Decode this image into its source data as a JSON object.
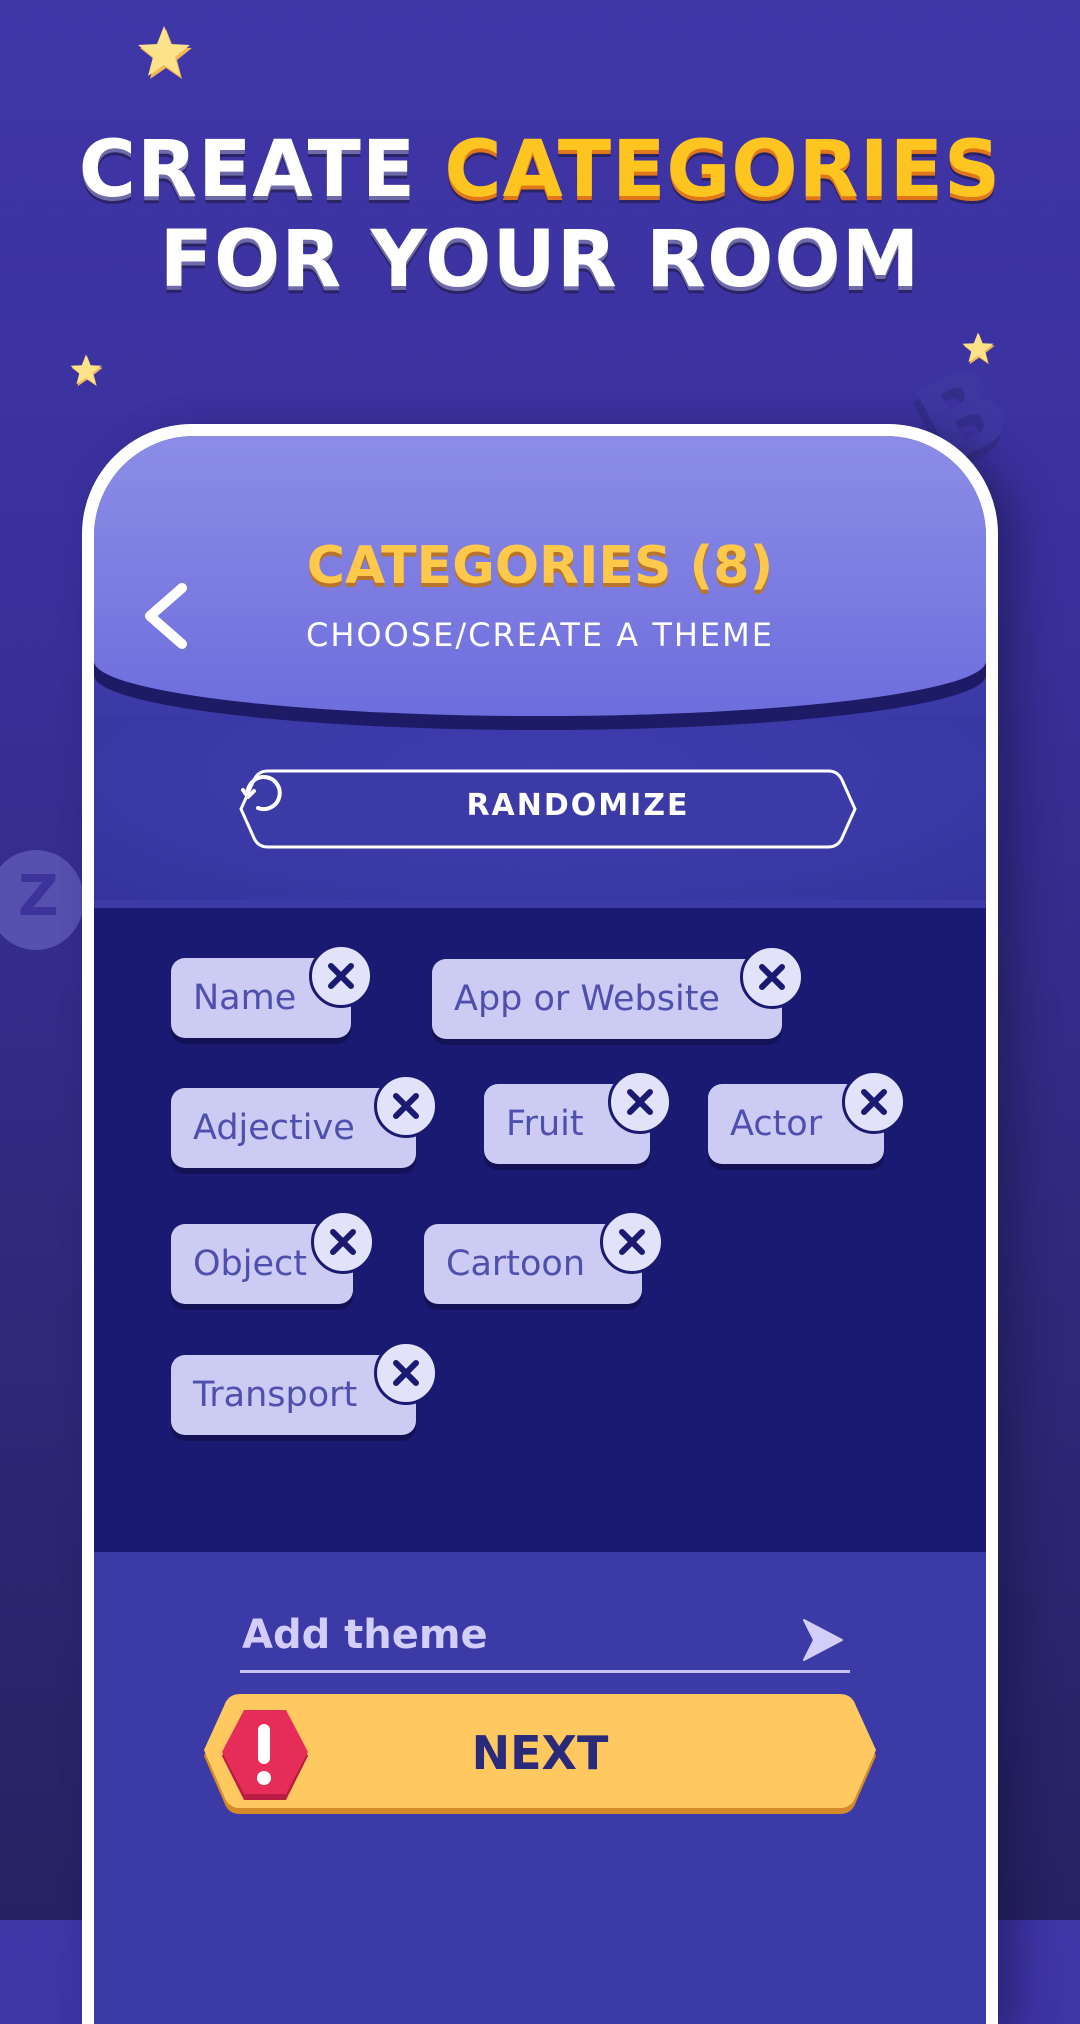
{
  "promo": {
    "line1_prefix": "CREATE ",
    "line1_highlight": "CATEGORIES",
    "line2": "FOR YOUR ROOM"
  },
  "decorations": {
    "letter_right": "B",
    "letter_left": "Z"
  },
  "header": {
    "title": "CATEGORIES (8)",
    "subtitle": "CHOOSE/CREATE A THEME",
    "back_icon": "chevron-left-icon"
  },
  "randomize": {
    "label": "RANDOMIZE",
    "icon": "refresh-icon"
  },
  "categories": {
    "count": 8,
    "items": [
      {
        "label": "Name"
      },
      {
        "label": "App or Website"
      },
      {
        "label": "Adjective"
      },
      {
        "label": "Fruit"
      },
      {
        "label": "Actor"
      },
      {
        "label": "Object"
      },
      {
        "label": "Cartoon"
      },
      {
        "label": "Transport"
      }
    ],
    "remove_icon": "close-icon"
  },
  "add_theme": {
    "placeholder": "Add theme",
    "value": "",
    "send_icon": "send-arrow-icon"
  },
  "next": {
    "label": "NEXT",
    "warning_icon": "exclamation-icon"
  },
  "colors": {
    "accent_yellow": "#fec84a",
    "tag_bg": "#cbcbf3",
    "tag_text": "#4f4fae",
    "warning_red": "#e62c58",
    "panel_dark": "#1b1a72"
  }
}
